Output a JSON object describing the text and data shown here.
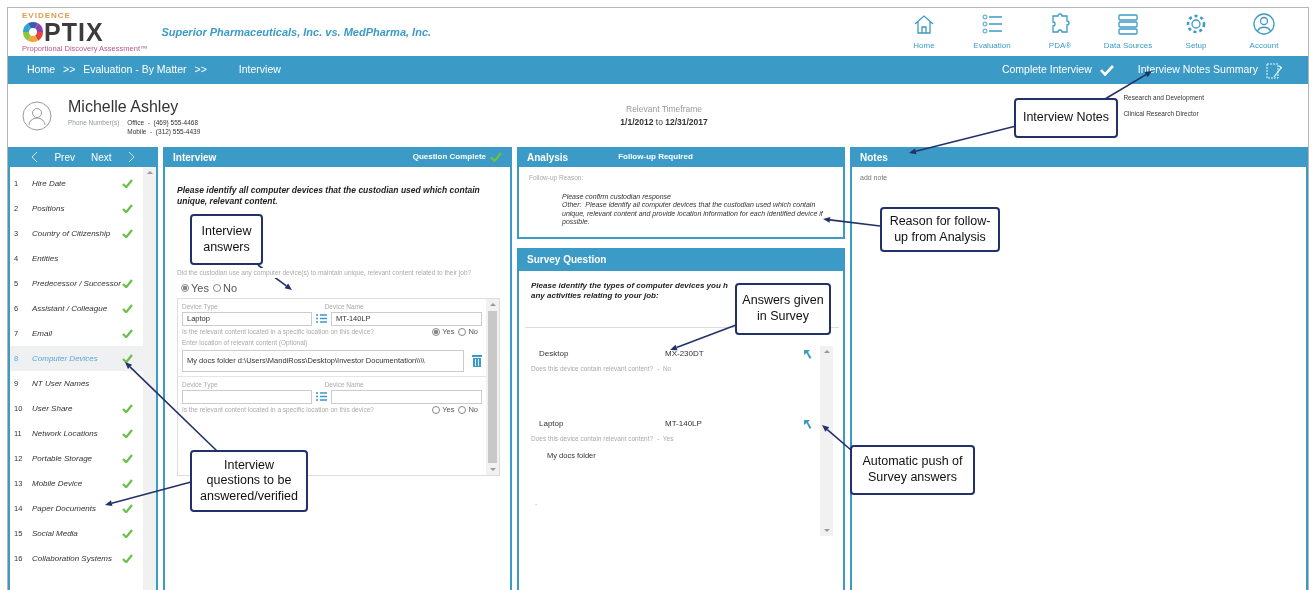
{
  "header": {
    "logo_top": "EVIDENCE",
    "logo_word": "PTIX",
    "logo_tagline": "Proportional Discovery Assessment™",
    "matter_title": "Superior Pharmaceuticals, Inc. vs. MedPharma, Inc."
  },
  "nav": [
    {
      "label": "Home",
      "kind": "home"
    },
    {
      "label": "Evaluation",
      "kind": "list"
    },
    {
      "label": "PDA®",
      "kind": "puzzle"
    },
    {
      "label": "Data Sources",
      "kind": "server"
    },
    {
      "label": "Setup",
      "kind": "gear"
    },
    {
      "label": "Account",
      "kind": "user"
    }
  ],
  "breadcrumbs": [
    {
      "kind": "link",
      "text": "Home"
    },
    {
      "kind": "separator",
      "text": ">>"
    },
    {
      "kind": "link",
      "text": "Evaluation - By Matter"
    },
    {
      "kind": "separator",
      "text": ">>"
    },
    {
      "kind": "current",
      "text": "Interview"
    }
  ],
  "actions": [
    {
      "label": "Complete Interview",
      "kind": "check"
    },
    {
      "label": "Interview Notes Summary",
      "kind": "notes"
    }
  ],
  "custodian": {
    "name": "Michelle Ashley",
    "phone_label": "Phone Number(s)",
    "phones": [
      "Office  -  (469) 555-4468",
      "Mobile  -  (312) 555-4439"
    ]
  },
  "timeframe": {
    "label": "Relevant Timeframe",
    "range": "**1/1/2012** to **12/31/2017**"
  },
  "department": [
    "Research and Development",
    "Clinical Research Director"
  ],
  "sidebar": {
    "prev": "Prev",
    "next": "Next",
    "items": [
      {
        "number": "1",
        "label": "Hire Date",
        "checked": true,
        "selected": false
      },
      {
        "number": "2",
        "label": "Positions",
        "checked": true,
        "selected": false
      },
      {
        "number": "3",
        "label": "Country of Citizenship",
        "checked": true,
        "selected": false
      },
      {
        "number": "4",
        "label": "Entities",
        "checked": false,
        "selected": false
      },
      {
        "number": "5",
        "label": "Predecessor / Successor",
        "checked": true,
        "selected": false
      },
      {
        "number": "6",
        "label": "Assistant / Colleague",
        "checked": true,
        "selected": false
      },
      {
        "number": "7",
        "label": "Email",
        "checked": true,
        "selected": false
      },
      {
        "number": "8",
        "label": "Computer Devices",
        "checked": true,
        "selected": true
      },
      {
        "number": "9",
        "label": "NT User Names",
        "checked": false,
        "selected": false
      },
      {
        "number": "10",
        "label": "User Share",
        "checked": true,
        "selected": false
      },
      {
        "number": "11",
        "label": "Network Locations",
        "checked": true,
        "selected": false
      },
      {
        "number": "12",
        "label": "Portable Storage",
        "checked": true,
        "selected": false
      },
      {
        "number": "13",
        "label": "Mobile Device",
        "checked": true,
        "selected": false
      },
      {
        "number": "14",
        "label": "Paper Documents",
        "checked": true,
        "selected": false
      },
      {
        "number": "15",
        "label": "Social Media",
        "checked": true,
        "selected": false
      },
      {
        "number": "16",
        "label": "Collaboration Systems",
        "checked": true,
        "selected": false
      }
    ]
  },
  "interview": {
    "title": "Interview",
    "status": "Question Complete",
    "question": "Please identify all computer devices that the custodian used which contain unique, relevant content.",
    "sub_question": "Did the custodian use any computer device(s) to maintain unique, relevant content related to their job?",
    "options": [
      {
        "label": "Yes",
        "selected": true
      },
      {
        "label": "No",
        "selected": false
      }
    ],
    "devices": [
      {
        "type_label": "Device Type",
        "type": "Laptop",
        "name_label": "Device Name",
        "name": "MT-140LP",
        "location_question": "Is the relevant content located in a specific location on this device?",
        "options": [
          {
            "label": "Yes",
            "selected": true
          },
          {
            "label": "No",
            "selected": false
          }
        ],
        "location_label": "Enter location of relevant content (Optional)",
        "location": "My docs folder d:\\Users\\MandiRoss\\Desktop\\Investor Documentation\\\\\\\\"
      },
      {
        "type_label": "Device Type",
        "name_label": "Device Name",
        "location_question": "Is the relevant content located in a specific location on this device?",
        "options": [
          {
            "label": "Yes",
            "selected": false
          },
          {
            "label": "No",
            "selected": false
          }
        ]
      }
    ]
  },
  "analysis": {
    "title": "Analysis",
    "status": "Follow-up Required",
    "reason_label": "Follow-up Reason:",
    "reason_lines": [
      "Please confirm custodian response",
      "Other:  Please identify all computer devices that the custodian used which contain unique, relevant content and provide location information for each identified device if possible."
    ]
  },
  "survey": {
    "title": "Survey Question",
    "question_lines": [
      "Please identify the types of computer devices you h",
      "any activities relating to your job:"
    ],
    "answers": [
      {
        "type": "Desktop",
        "name": "MX-230DT",
        "question": "Does this device contain relevant content?",
        "answer": "-  No"
      },
      {
        "type": "Laptop",
        "name": "MT-140LP",
        "question": "Does this device contain relevant content?",
        "answer": "-  Yes",
        "location": "My docs folder",
        "trailing": "-"
      }
    ]
  },
  "notes": {
    "title": "Notes",
    "placeholder": "add note"
  },
  "callouts": [
    {
      "text": "Interview Notes"
    },
    {
      "text": "Interview answers"
    },
    {
      "text": "Reason for follow-up from Analysis"
    },
    {
      "text": "Answers given in Survey"
    },
    {
      "text": "Interview questions to be answered/verified"
    },
    {
      "text": "Automatic push of Survey answers"
    }
  ]
}
